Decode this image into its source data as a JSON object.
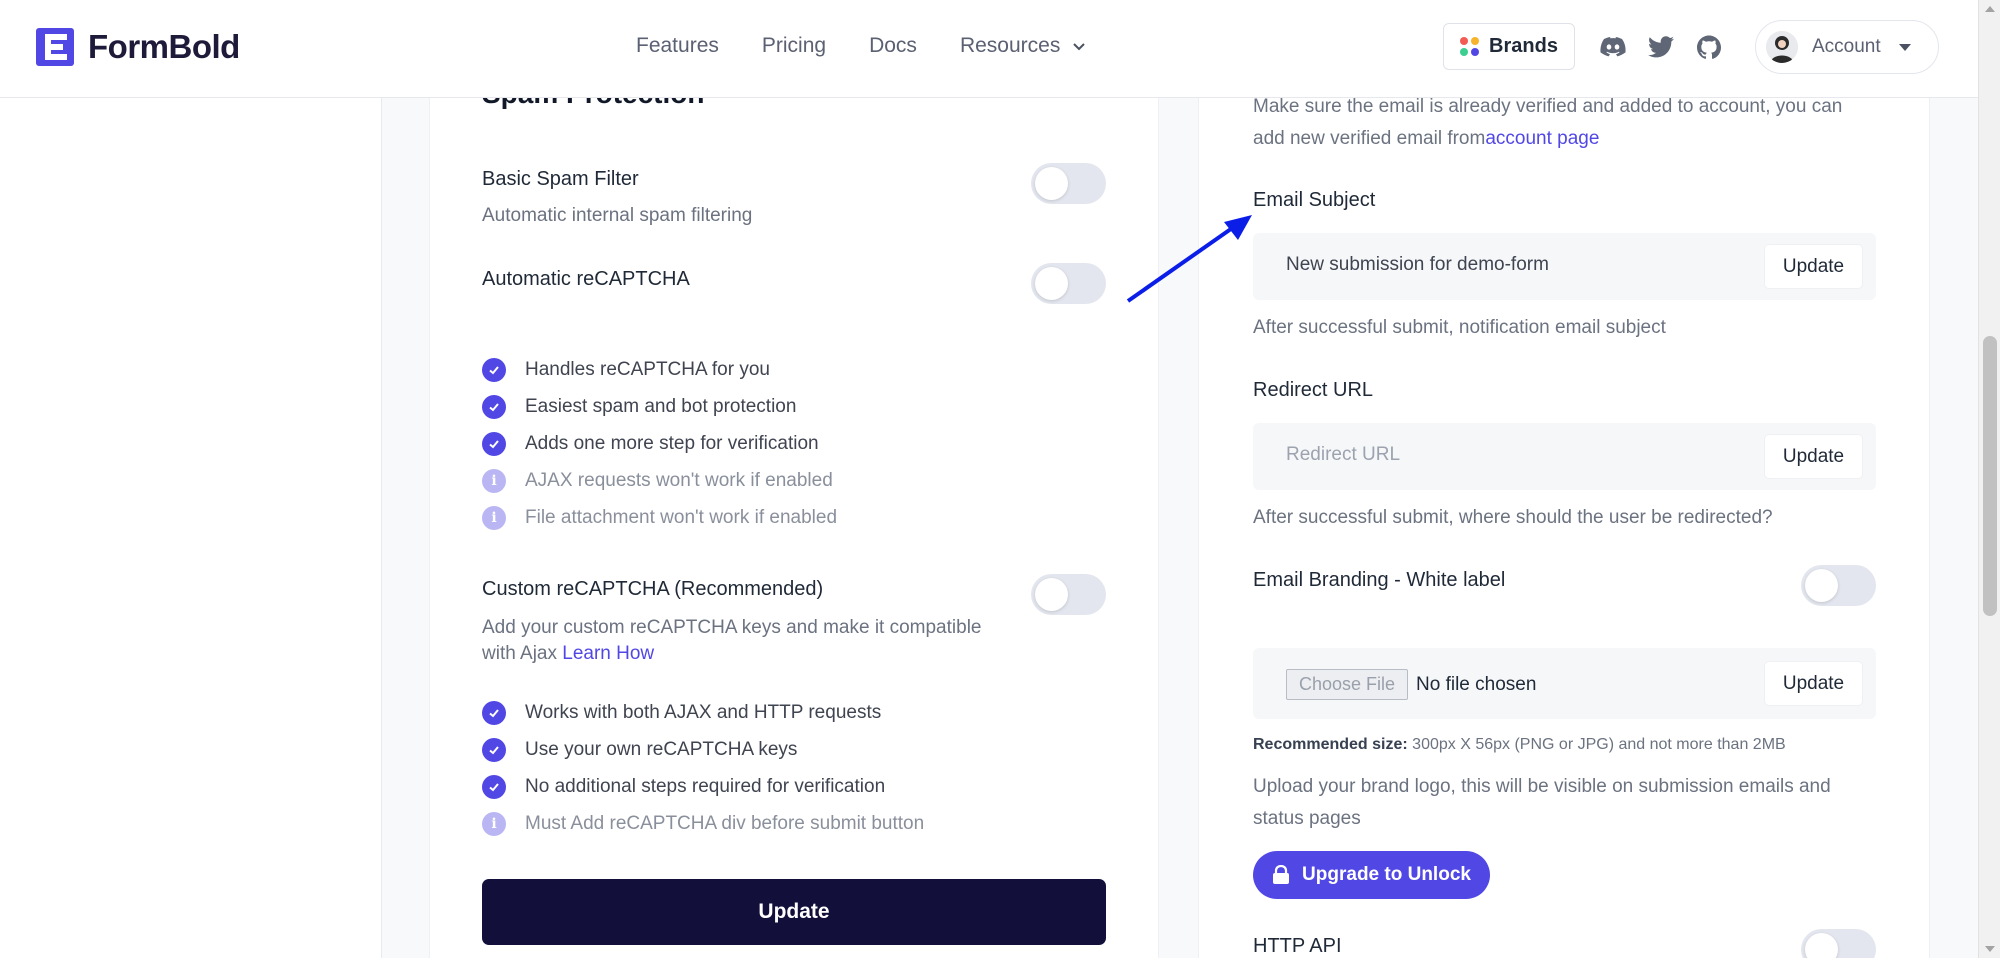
{
  "header": {
    "logo_text": "FormBold",
    "nav": [
      "Features",
      "Pricing",
      "Docs",
      "Resources"
    ],
    "brands_label": "Brands",
    "account_label": "Account"
  },
  "left": {
    "section_title": "Spam Protection",
    "basic_spam": {
      "label": "Basic Spam Filter",
      "sub": "Automatic internal spam filtering"
    },
    "auto_recaptcha": {
      "label": "Automatic reCAPTCHA"
    },
    "auto_list": [
      {
        "text": "Handles reCAPTCHA for you",
        "kind": "check"
      },
      {
        "text": "Easiest spam and bot protection",
        "kind": "check"
      },
      {
        "text": "Adds one more step for verification",
        "kind": "check"
      },
      {
        "text": "AJAX requests won't work if enabled",
        "kind": "info"
      },
      {
        "text": "File attachment won't work if enabled",
        "kind": "info"
      }
    ],
    "custom_recaptcha": {
      "label": "Custom reCAPTCHA (Recommended)",
      "sub_line1": "Add your custom reCAPTCHA keys and make it compatible",
      "sub_line2": "with Ajax",
      "learn_link": "Learn How"
    },
    "custom_list": [
      {
        "text": "Works with both AJAX and HTTP requests",
        "kind": "check"
      },
      {
        "text": "Use your own reCAPTCHA keys",
        "kind": "check"
      },
      {
        "text": "No additional steps required for verification",
        "kind": "check"
      },
      {
        "text": "Must Add reCAPTCHA div before submit button",
        "kind": "info"
      }
    ],
    "update_label": "Update"
  },
  "right": {
    "verify_line1": "Make sure the email is already verified and added to account, you can",
    "verify_line2": "add new verified email from",
    "account_page_link": "account page",
    "email_subject": {
      "label": "Email Subject",
      "value": "New submission for demo-form",
      "update": "Update",
      "help": "After successful submit, notification email subject"
    },
    "redirect": {
      "label": "Redirect URL",
      "placeholder": "Redirect URL",
      "update": "Update",
      "help": "After successful submit, where should the user be redirected?"
    },
    "branding": {
      "label": "Email Branding - White label",
      "choose_file": "Choose File",
      "no_file": "No file chosen",
      "update": "Update",
      "rec_label": "Recommended size:",
      "rec_value": "300px X 56px (PNG or JPG) and not more than 2MB",
      "help_line1": "Upload your brand logo, this will be visible on submission emails and",
      "help_line2": "status pages",
      "upgrade": "Upgrade to Unlock"
    },
    "http_api": {
      "label": "HTTP API"
    }
  },
  "colors": {
    "accent": "#5147e5",
    "dark_button": "#12103a",
    "toggle_off": "#e3e6ee"
  }
}
